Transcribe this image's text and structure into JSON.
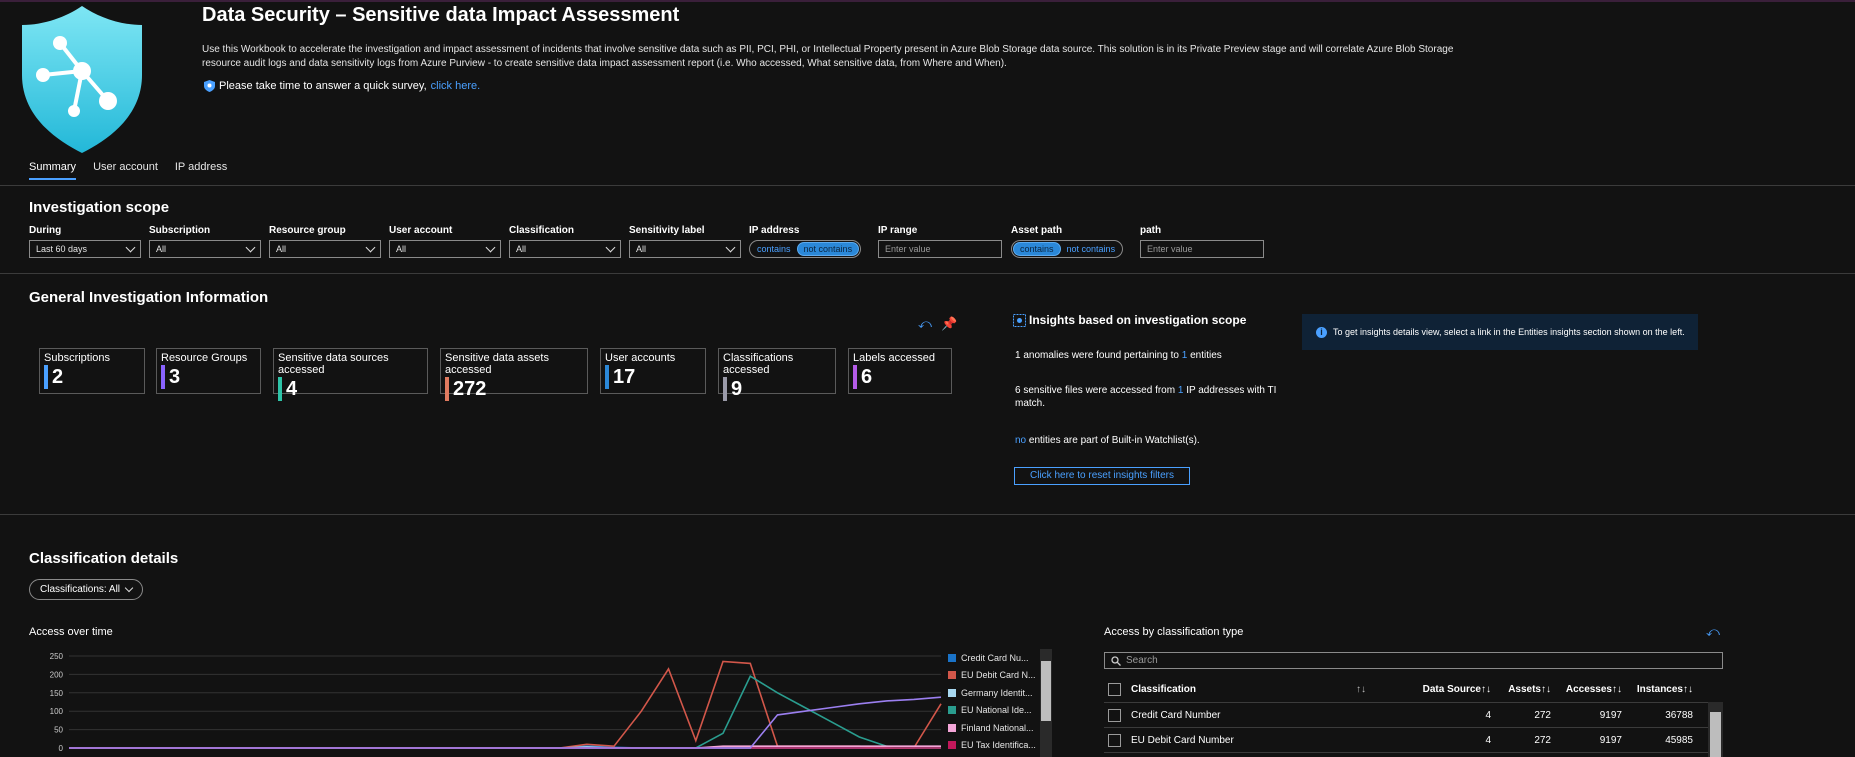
{
  "header": {
    "title": "Data Security – Sensitive data Impact Assessment",
    "description": "Use this Workbook to accelerate the investigation and impact assessment of incidents that involve sensitive data such as PII, PCI, PHI, or Intellectual Property present in Azure Blob Storage data source. This solution is in its Private Preview stage and will correlate Azure Blob Storage resource audit logs and data sensitivity logs from Azure Purview - to create sensitive data impact assessment report (i.e. Who accessed, What sensitive data, from Where and When).",
    "survey_text": "Please take time to answer a quick survey,",
    "survey_link": "click here."
  },
  "tabs": [
    "Summary",
    "User account",
    "IP address"
  ],
  "scope": {
    "title": "Investigation scope",
    "filters": {
      "during": {
        "label": "During",
        "value": "Last 60 days"
      },
      "subscription": {
        "label": "Subscription",
        "value": "All"
      },
      "resource_group": {
        "label": "Resource group",
        "value": "All"
      },
      "user_account": {
        "label": "User account",
        "value": "All"
      },
      "classification": {
        "label": "Classification",
        "value": "All"
      },
      "sensitivity": {
        "label": "Sensitivity label",
        "value": "All"
      },
      "ip_address": {
        "label": "IP address",
        "opt1": "contains",
        "opt2": "not contains",
        "selected": "not contains"
      },
      "ip_range": {
        "label": "IP range",
        "placeholder": "Enter value"
      },
      "asset_path": {
        "label": "Asset path",
        "opt1": "contains",
        "opt2": "not contains",
        "selected": "contains"
      },
      "path": {
        "label": "path",
        "placeholder": "Enter value"
      }
    }
  },
  "general": {
    "title": "General Investigation Information",
    "tiles": [
      {
        "label": "Subscriptions",
        "value": "2",
        "color": "#4aa0ff"
      },
      {
        "label": "Resource Groups",
        "value": "3",
        "color": "#8a63ff"
      },
      {
        "label": "Sensitive data sources accessed",
        "value": "4",
        "color": "#2ec4a8"
      },
      {
        "label": "Sensitive data assets accessed",
        "value": "272",
        "color": "#e07a5f"
      },
      {
        "label": "User accounts",
        "value": "17",
        "color": "#2b88d8"
      },
      {
        "label": "Classifications accessed",
        "value": "9",
        "color": "#9a9aa8"
      },
      {
        "label": "Labels accessed",
        "value": "6",
        "color": "#b45be8"
      }
    ],
    "insights": {
      "title": "Insights based on investigation scope",
      "l1a": "1 anomalies were found pertaining to",
      "l1n": "1",
      "l1b": "entities",
      "l2a": "6 sensitive files were accessed from",
      "l2n": "1",
      "l2b": "IP addresses with TI",
      "l2c": "match.",
      "l3n": "no",
      "l3b": "entities are part of Built-in Watchlist(s).",
      "reset": "Click here to reset insights filters"
    },
    "info": "To get insights details view, select a link in the Entities insights section shown on the left."
  },
  "classification": {
    "title": "Classification details",
    "filter_pill": "Classifications: All",
    "chart_title": "Access over time",
    "table_title": "Access by classification type",
    "search_placeholder": "Search",
    "columns": [
      "Classification",
      "↑↓",
      "Data Source↑↓",
      "Assets↑↓",
      "Accesses↑↓",
      "Instances↑↓"
    ],
    "rows": [
      {
        "name": "Credit Card Number",
        "ds": "4",
        "assets": "272",
        "accesses": "9197",
        "instances": "36788"
      },
      {
        "name": "EU Debit Card Number",
        "ds": "4",
        "assets": "272",
        "accesses": "9197",
        "instances": "45985"
      }
    ]
  },
  "chart_data": {
    "type": "line",
    "title": "Access over time",
    "ylim": [
      0,
      250
    ],
    "yticks": [
      "250",
      "200",
      "150",
      "100",
      "50",
      "0"
    ],
    "x": [
      0,
      1,
      2,
      3,
      4,
      5,
      6,
      7,
      8,
      9,
      10,
      11,
      12,
      13,
      14,
      15,
      16,
      17,
      18,
      19,
      20,
      21,
      22,
      23,
      24,
      25,
      26,
      27,
      28,
      29,
      30,
      31,
      32
    ],
    "series": [
      {
        "name": "Credit Card Nu...",
        "color": "#1a73c8",
        "values": [
          0,
          0,
          0,
          0,
          0,
          0,
          0,
          0,
          0,
          0,
          0,
          0,
          0,
          0,
          0,
          0,
          0,
          0,
          0,
          5,
          2,
          0,
          0,
          0,
          0,
          0,
          0,
          0,
          0,
          0,
          0,
          0,
          0
        ]
      },
      {
        "name": "EU Debit Card N...",
        "color": "#d2574a",
        "values": [
          0,
          0,
          0,
          0,
          0,
          0,
          0,
          0,
          0,
          0,
          0,
          0,
          0,
          0,
          0,
          0,
          0,
          0,
          0,
          10,
          5,
          100,
          215,
          20,
          235,
          230,
          5,
          5,
          5,
          5,
          0,
          0,
          120
        ]
      },
      {
        "name": "Germany Identit...",
        "color": "#a8d8f0",
        "values": [
          0,
          0,
          0,
          0,
          0,
          0,
          0,
          0,
          0,
          0,
          0,
          0,
          0,
          0,
          0,
          0,
          0,
          0,
          0,
          3,
          0,
          0,
          0,
          0,
          0,
          0,
          0,
          0,
          0,
          0,
          0,
          0,
          0
        ]
      },
      {
        "name": "EU National Ide...",
        "color": "#2a9d8f",
        "values": [
          0,
          0,
          0,
          0,
          0,
          0,
          0,
          0,
          0,
          0,
          0,
          0,
          0,
          0,
          0,
          0,
          0,
          0,
          0,
          0,
          0,
          0,
          0,
          0,
          40,
          195,
          150,
          110,
          70,
          30,
          5,
          0,
          0
        ]
      },
      {
        "name": "Finland National...",
        "color": "#f4a6d8",
        "values": [
          0,
          0,
          0,
          0,
          0,
          0,
          0,
          0,
          0,
          0,
          0,
          0,
          0,
          0,
          0,
          0,
          0,
          0,
          0,
          0,
          0,
          0,
          0,
          0,
          5,
          5,
          5,
          5,
          5,
          5,
          5,
          5,
          5
        ]
      },
      {
        "name": "EU Tax Identifica...",
        "color": "#c2185b",
        "values": [
          0,
          0,
          0,
          0,
          0,
          0,
          0,
          0,
          0,
          0,
          0,
          0,
          0,
          0,
          0,
          0,
          0,
          0,
          0,
          0,
          0,
          0,
          0,
          0,
          0,
          0,
          0,
          0,
          0,
          0,
          0,
          0,
          0
        ]
      },
      {
        "name": "",
        "color": "#9b7ff0",
        "values": [
          0,
          0,
          0,
          0,
          0,
          0,
          0,
          0,
          0,
          0,
          0,
          0,
          0,
          0,
          0,
          0,
          0,
          0,
          0,
          0,
          0,
          0,
          0,
          0,
          0,
          0,
          90,
          100,
          110,
          120,
          128,
          132,
          138
        ]
      }
    ]
  }
}
